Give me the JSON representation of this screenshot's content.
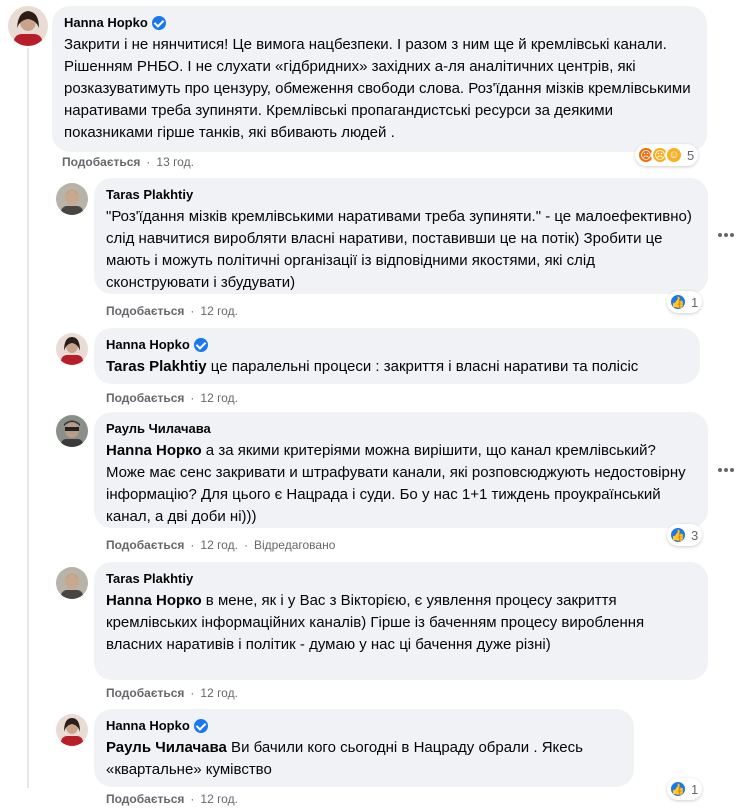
{
  "comments": [
    {
      "author": "Hanna Hopko",
      "verified": true,
      "mention": "",
      "text": "Закрити і не нянчитися! Це вимога нацбезпеки. І разом з ним ще й кремлівські канали. Рішенням РНБО. І не слухати «гідбридних» західних а-ля аналітичних центрів, які розказуватимуть про цензуру, обмеження свободи слова. Роз'їдання мізків кремлівськими наративами треба зупиняти. Кремлівські пропагандистські ресурси за деякими показниками гірше танків, які вбивають людей .",
      "like": "Подобається",
      "time": "13 год.",
      "reaction_count": "5"
    },
    {
      "author": "Taras Plakhtiy",
      "verified": false,
      "mention": "",
      "text": "\"Роз'їдання мізків кремлівськими наративами треба зупиняти.\" - це малоефективно) слід навчитися виробляти власні наративи, поставивши це на потік) Зробити це мають і можуть політичні організації із відповідними якостями, які слід сконструювати і збудувати)",
      "like": "Подобається",
      "time": "12 год.",
      "reaction_count": "1"
    },
    {
      "author": "Hanna Hopko",
      "verified": true,
      "mention": "Taras Plakhtiy",
      "text": " це паралельні процеси : закриття і власні наративи та полісіс",
      "like": "Подобається",
      "time": "12 год."
    },
    {
      "author": "Рауль Чилачава",
      "verified": false,
      "mention": "Hanna Норко",
      "text": " а за якими критеріями можна вирішити, що канал кремлівський? Може має сенс закривати и штрафувати канали, які розповсюджують недостовірну інформацію? Для цього є Нацрада і суди. Бо у нас 1+1 тиждень проукраїнський канал, а дві доби ні)))",
      "like": "Подобається",
      "time": "12 год.",
      "edited": "Відредаговано",
      "reaction_count": "3"
    },
    {
      "author": "Taras Plakhtiy",
      "verified": false,
      "mention": "Hanna Норко",
      "text": " в мене, як і у Вас з Вікторією, є уявлення процесу закриття кремлівських інформаційних каналів) Гірше із баченням процесу вироблення власних наративів і політик - думаю у нас ці бачення дуже різні)",
      "like": "Подобається",
      "time": "12 год."
    },
    {
      "author": "Hanna Hopko",
      "verified": true,
      "mention": "Рауль Чилачава",
      "text": " Ви бачили кого сьогодні в Нацраду обрали . Якесь «квартальне» кумівство",
      "like": "Подобається",
      "time": "12 год.",
      "reaction_count": "1"
    }
  ],
  "separator": "·",
  "icons": {
    "verified": "verified-badge-icon",
    "more": "more-options-icon",
    "like_reaction": "like-reaction-icon",
    "angry_reaction": "angry-reaction-icon",
    "sad_reaction": "sad-reaction-icon",
    "haha_reaction": "haha-reaction-icon"
  },
  "colors": {
    "bubble": "#f0f2f5",
    "meta": "#65676b",
    "verified": "#1877f2"
  }
}
